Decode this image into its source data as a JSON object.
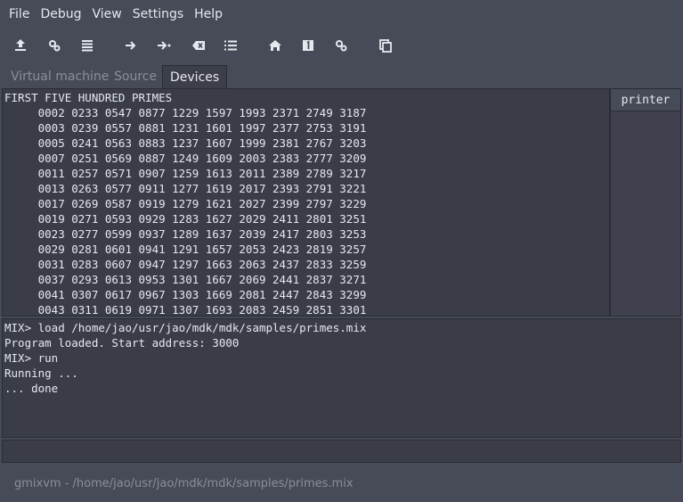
{
  "menu": [
    "File",
    "Debug",
    "View",
    "Settings",
    "Help"
  ],
  "toolbar": {
    "icons": [
      "load-icon",
      "compile-icon",
      "list-icon",
      "step-icon",
      "step-into-icon",
      "clear-icon",
      "bulleted-list-icon",
      "home-icon",
      "badge-one-icon",
      "settings-gear-icon",
      "copy-icon"
    ]
  },
  "tabs": [
    "Virtual machine",
    "Source",
    "Devices"
  ],
  "active_tab": "Devices",
  "devices": {
    "side_header": "printer",
    "output_title": "FIRST FIVE HUNDRED PRIMES",
    "rows": [
      "     0002 0233 0547 0877 1229 1597 1993 2371 2749 3187",
      "     0003 0239 0557 0881 1231 1601 1997 2377 2753 3191",
      "     0005 0241 0563 0883 1237 1607 1999 2381 2767 3203",
      "     0007 0251 0569 0887 1249 1609 2003 2383 2777 3209",
      "     0011 0257 0571 0907 1259 1613 2011 2389 2789 3217",
      "     0013 0263 0577 0911 1277 1619 2017 2393 2791 3221",
      "     0017 0269 0587 0919 1279 1621 2027 2399 2797 3229",
      "     0019 0271 0593 0929 1283 1627 2029 2411 2801 3251",
      "     0023 0277 0599 0937 1289 1637 2039 2417 2803 3253",
      "     0029 0281 0601 0941 1291 1657 2053 2423 2819 3257",
      "     0031 0283 0607 0947 1297 1663 2063 2437 2833 3259",
      "     0037 0293 0613 0953 1301 1667 2069 2441 2837 3271",
      "     0041 0307 0617 0967 1303 1669 2081 2447 2843 3299",
      "     0043 0311 0619 0971 1307 1693 2083 2459 2851 3301"
    ]
  },
  "console": {
    "lines": [
      "MIX> load /home/jao/usr/jao/mdk/mdk/samples/primes.mix",
      "Program loaded. Start address: 3000",
      "MIX> run",
      "Running ...",
      "... done"
    ]
  },
  "command_entry": {
    "value": ""
  },
  "status": "gmixvm - /home/jao/usr/jao/mdk/mdk/samples/primes.mix"
}
